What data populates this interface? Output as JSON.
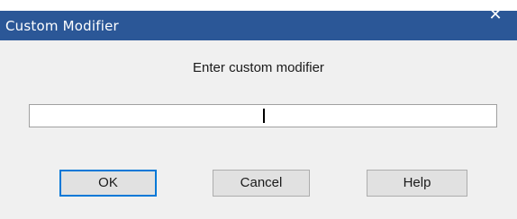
{
  "dialog": {
    "title": "Custom Modifier",
    "close_icon": "close-icon",
    "prompt": "Enter custom modifier",
    "input_value": ""
  },
  "buttons": {
    "ok_label": "OK",
    "cancel_label": "Cancel",
    "help_label": "Help"
  },
  "colors": {
    "titlebar": "#2b5797",
    "dialog_background": "#f0f0f0",
    "default_button_border": "#0078d7"
  }
}
